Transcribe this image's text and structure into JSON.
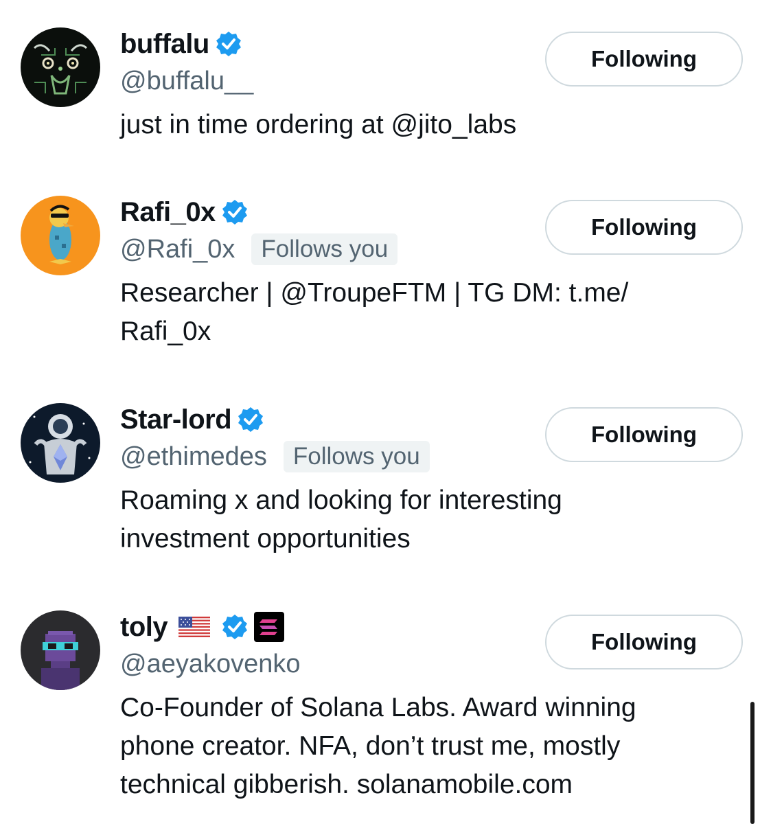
{
  "users": [
    {
      "display_name": "buffalu",
      "handle": "@buffalu__",
      "follows_you": "",
      "bio": "just in time ordering at @jito_labs",
      "button_label": "Following"
    },
    {
      "display_name": "Rafi_0x",
      "handle": "@Rafi_0x",
      "follows_you": "Follows you",
      "bio": "Researcher | @TroupeFTM | TG DM: t.me/ Rafi_0x",
      "button_label": "Following"
    },
    {
      "display_name": "Star-lord",
      "handle": "@ethimedes",
      "follows_you": "Follows you",
      "bio": "Roaming x and looking for interesting investment opportunities",
      "button_label": "Following"
    },
    {
      "display_name": "toly",
      "handle": "@aeyakovenko",
      "follows_you": "",
      "bio": "Co-Founder of Solana Labs. Award winning phone creator. NFA, don’t trust me, mostly technical gibberish. solanamobile.com",
      "button_label": "Following"
    }
  ],
  "icons": {
    "verified": "verified-badge-icon",
    "flag": "us-flag-icon",
    "solana": "solana-logo-icon"
  },
  "colors": {
    "verified_blue": "#1d9bf0",
    "text_primary": "#0f1419",
    "text_secondary": "#536471",
    "badge_bg": "#eff3f4",
    "button_border": "#cfd9de"
  }
}
